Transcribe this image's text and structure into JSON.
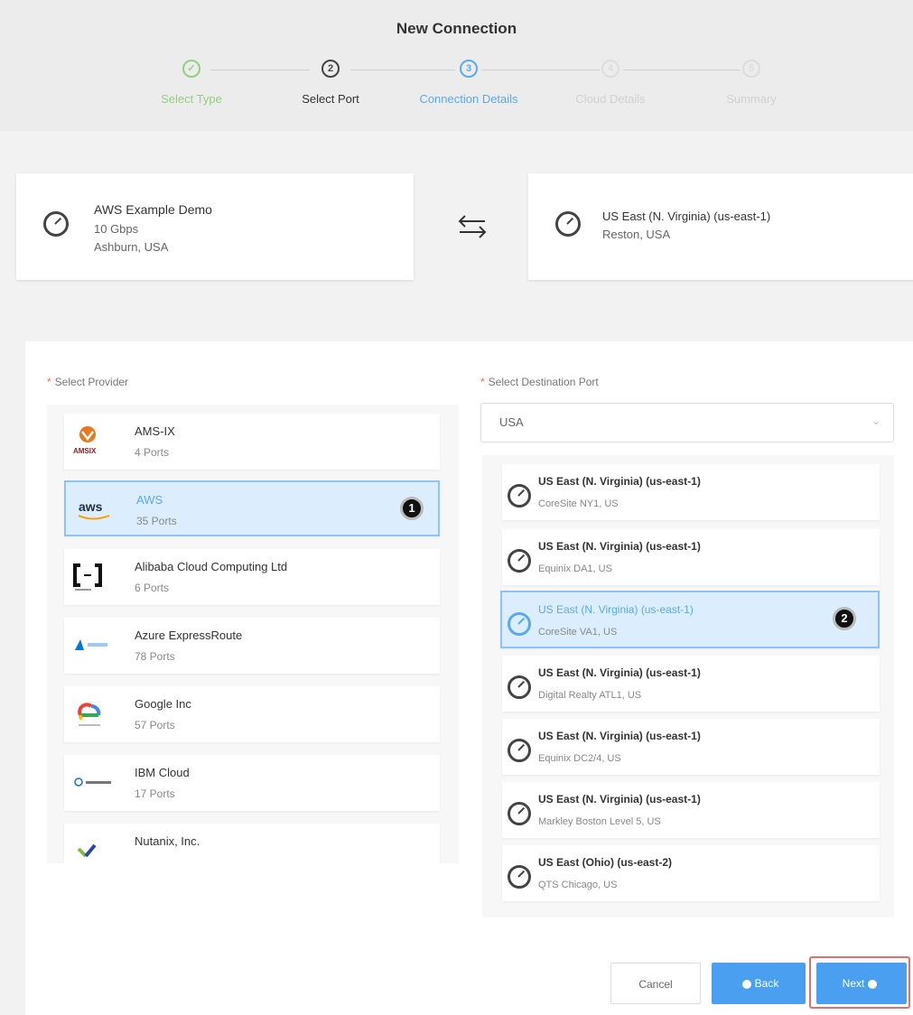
{
  "dialog": {
    "title": "New Connection"
  },
  "stepper": {
    "steps": [
      {
        "number": "✓",
        "label": "Select Type",
        "state": "done"
      },
      {
        "number": "2",
        "label": "Select Port",
        "state": "current"
      },
      {
        "number": "3",
        "label": "Connection Details",
        "state": "active"
      },
      {
        "number": "4",
        "label": "Cloud Details",
        "state": "pending"
      },
      {
        "number": "5",
        "label": "Summary",
        "state": "pending"
      }
    ]
  },
  "source": {
    "name": "AWS Example Demo",
    "speed": "10 Gbps",
    "location": "Ashburn, USA"
  },
  "destination": {
    "name": "US East (N. Virginia) (us-east-1)",
    "location": "Reston, USA"
  },
  "provider": {
    "label": "Select Provider",
    "required_mark": "*",
    "items": [
      {
        "name": "AMS-IX",
        "ports": "4 Ports",
        "logo": "amsix-logo",
        "selected": false
      },
      {
        "name": "AWS",
        "ports": "35 Ports",
        "logo": "aws-logo",
        "selected": true
      },
      {
        "name": "Alibaba Cloud Computing Ltd",
        "ports": "6 Ports",
        "logo": "alibaba-logo",
        "selected": false
      },
      {
        "name": "Azure ExpressRoute",
        "ports": "78 Ports",
        "logo": "azure-logo",
        "selected": false
      },
      {
        "name": "Google Inc",
        "ports": "57 Ports",
        "logo": "google-cloud-logo",
        "selected": false
      },
      {
        "name": "IBM Cloud",
        "ports": "17 Ports",
        "logo": "ibm-cloud-logo",
        "selected": false
      },
      {
        "name": "Nutanix, Inc.",
        "ports": "",
        "logo": "nutanix-logo",
        "selected": false
      }
    ],
    "badge": "1"
  },
  "destination_port": {
    "label": "Select Destination Port",
    "required_mark": "*",
    "country_value": "USA",
    "items": [
      {
        "name": "US East (N. Virginia) (us-east-1)",
        "site": "CoreSite NY1, US",
        "selected": false
      },
      {
        "name": "US East (N. Virginia) (us-east-1)",
        "site": "Equinix DA1, US",
        "selected": false
      },
      {
        "name": "US East (N. Virginia) (us-east-1)",
        "site": "CoreSite VA1, US",
        "selected": true
      },
      {
        "name": "US East (N. Virginia) (us-east-1)",
        "site": "Digital Realty ATL1, US",
        "selected": false
      },
      {
        "name": "US East (N. Virginia) (us-east-1)",
        "site": "Equinix DC2/4, US",
        "selected": false
      },
      {
        "name": "US East (N. Virginia) (us-east-1)",
        "site": "Markley Boston Level 5, US",
        "selected": false
      },
      {
        "name": "US East (Ohio) (us-east-2)",
        "site": "QTS Chicago, US",
        "selected": false
      }
    ],
    "badge": "2"
  },
  "buttons": {
    "cancel": "Cancel",
    "back": "Back",
    "next": "Next"
  },
  "colors": {
    "primary": "#4a9ff0",
    "done": "#8fd17c",
    "selected_bg": "#dceefd",
    "required": "#f56c6c",
    "highlight": "#e07070"
  }
}
